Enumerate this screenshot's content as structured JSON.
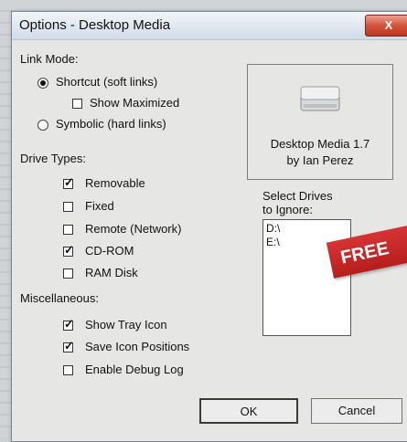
{
  "window": {
    "title": "Options - Desktop Media",
    "close_label": "X"
  },
  "link_mode": {
    "label": "Link Mode:",
    "shortcut": "Shortcut (soft links)",
    "show_maximized": "Show Maximized",
    "symbolic": "Symbolic (hard links)",
    "selected": "shortcut"
  },
  "about": {
    "name": "Desktop Media 1.7",
    "author": "by Ian Perez"
  },
  "drive_types": {
    "label": "Drive Types:",
    "items": [
      {
        "label": "Removable",
        "checked": true
      },
      {
        "label": "Fixed",
        "checked": false
      },
      {
        "label": "Remote (Network)",
        "checked": false
      },
      {
        "label": "CD-ROM",
        "checked": true
      },
      {
        "label": "RAM Disk",
        "checked": false
      }
    ]
  },
  "ignore": {
    "label_line1": "Select Drives",
    "label_line2": "to Ignore:",
    "drives": [
      "D:\\",
      "E:\\"
    ]
  },
  "misc": {
    "label": "Miscellaneous:",
    "items": [
      {
        "label": "Show Tray Icon",
        "checked": true
      },
      {
        "label": "Save Icon Positions",
        "checked": true
      },
      {
        "label": "Enable Debug Log",
        "checked": false
      }
    ]
  },
  "buttons": {
    "ok": "OK",
    "cancel": "Cancel"
  },
  "overlay_badge": "FREE",
  "colors": {
    "close_button": "#c0361f",
    "badge": "#c42a2a",
    "dialog_bg": "#e6e6e4"
  }
}
